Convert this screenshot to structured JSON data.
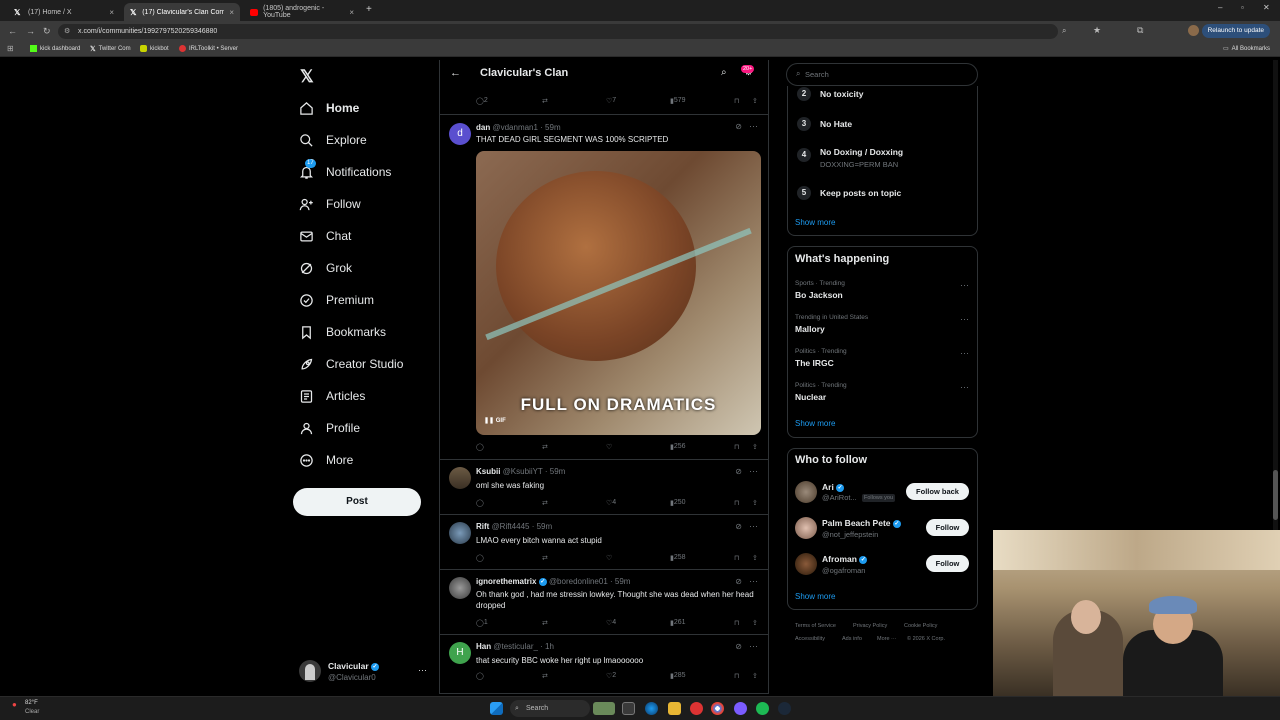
{
  "browser": {
    "tabs": [
      {
        "label": "(17) Home / X",
        "close": "×"
      },
      {
        "label": "(17) Clavicular's Clan Commun...",
        "close": "×"
      },
      {
        "label": "(1805) androgenic - YouTube",
        "close": "×"
      }
    ],
    "new_tab": "+",
    "url": "x.com/i/communities/1992797520259346880",
    "relaunch": "Relaunch to update",
    "bookmarks": [
      "kick dashboard",
      "Twitter Com",
      "kickbot",
      "IRLToolkit • Server"
    ],
    "all_bookmarks": "All Bookmarks"
  },
  "nav": {
    "items": [
      "Home",
      "Explore",
      "Notifications",
      "Follow",
      "Chat",
      "Grok",
      "Premium",
      "Bookmarks",
      "Creator Studio",
      "Articles",
      "Profile",
      "More"
    ],
    "notif_badge": "17",
    "post": "Post",
    "account_name": "Clavicular",
    "account_handle": "@Clavicular0",
    "account_more": "···"
  },
  "header": {
    "title": "Clavicular's Clan",
    "badge": "20+"
  },
  "top_actions": {
    "replies": "2",
    "likes": "7",
    "views": "579"
  },
  "tweets": [
    {
      "avatar_letter": "d",
      "name": "dan",
      "meta": "@vdanman1 · 59m",
      "text": "THAT DEAD GIRL SEGMENT WAS 100% SCRIPTED",
      "gif_caption": "FULL ON DRAMATICS",
      "gif_tag": "GIF",
      "replies": "",
      "likes": "",
      "views": "256",
      "avatar_color": "#5a4fcf"
    },
    {
      "name": "Ksubii",
      "meta": "@KsubiiYT · 59m",
      "text": "oml she was faking",
      "replies": "",
      "likes": "4",
      "views": "250"
    },
    {
      "name": "Rift",
      "meta": "@Rift4445 · 59m",
      "text": "LMAO every bitch wanna act stupid",
      "replies": "",
      "likes": "",
      "views": "258"
    },
    {
      "name": "ignorethematrix",
      "meta": "@boredonline01 · 59m",
      "text": "Oh thank god , had me stressin lowkey. Thought she was dead when her head dropped",
      "replies": "1",
      "likes": "4",
      "views": "261"
    },
    {
      "avatar_letter": "H",
      "name": "Han",
      "meta": "@testicular_ · 1h",
      "text": "that security BBC woke her right up lmaoooooo",
      "replies": "",
      "likes": "2",
      "views": "285",
      "avatar_color": "#3fa34d"
    }
  ],
  "search_placeholder": "Search",
  "rules": [
    {
      "n": "2",
      "title": "No toxicity",
      "sub": ""
    },
    {
      "n": "3",
      "title": "No Hate",
      "sub": ""
    },
    {
      "n": "4",
      "title": "No Doxing / Doxxing",
      "sub": "DOXXING=PERM BAN"
    },
    {
      "n": "5",
      "title": "Keep posts on topic",
      "sub": ""
    }
  ],
  "show_more": "Show more",
  "whats_happening": {
    "title": "What's happening",
    "trends": [
      {
        "meta": "Sports · Trending",
        "name": "Bo Jackson"
      },
      {
        "meta": "Trending in United States",
        "name": "Mallory"
      },
      {
        "meta": "Politics · Trending",
        "name": "The IRGC"
      },
      {
        "meta": "Politics · Trending",
        "name": "Nuclear"
      }
    ]
  },
  "who_to_follow": {
    "title": "Who to follow",
    "users": [
      {
        "name": "Ari",
        "handle": "@AriRot...",
        "follows_you": "Follows you",
        "button": "Follow back"
      },
      {
        "name": "Palm Beach Pete",
        "handle": "@not_jeffepstein",
        "follows_you": "",
        "button": "Follow"
      },
      {
        "name": "Afroman",
        "handle": "@ogafroman",
        "follows_you": "",
        "button": "Follow"
      }
    ]
  },
  "footer": {
    "links": [
      "Terms of Service",
      "Privacy Policy",
      "Cookie Policy",
      "Accessibility",
      "Ads info",
      "More ···"
    ],
    "copyright": "© 2026 X Corp."
  },
  "taskbar": {
    "weather_temp": "82°F",
    "weather_desc": "Clear",
    "search": "Search"
  },
  "colors": {
    "accent": "#1d9bf0",
    "bg": "#000000",
    "border": "#2f3336"
  }
}
